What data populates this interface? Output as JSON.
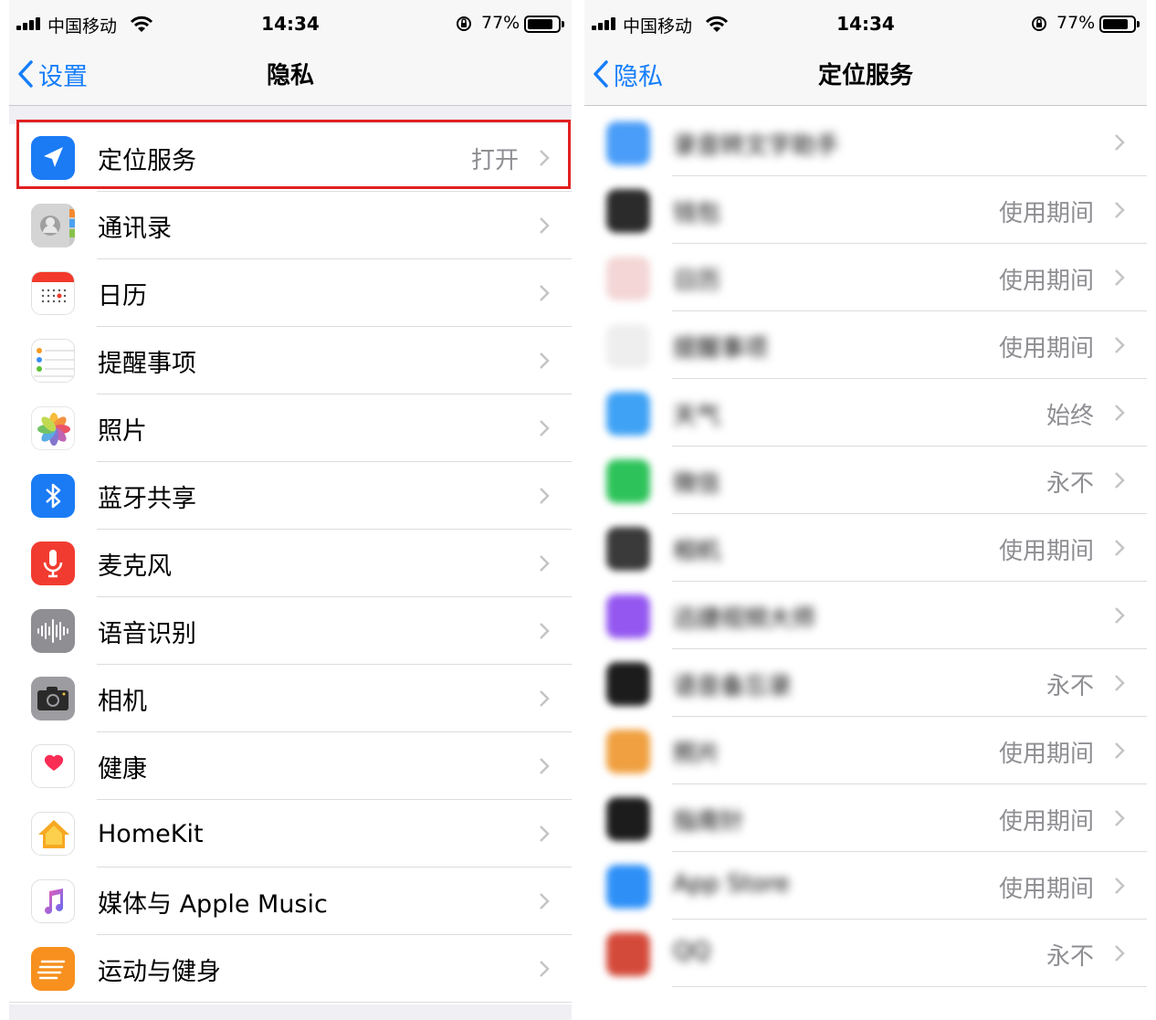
{
  "status_bar": {
    "carrier": "中国移动",
    "time": "14:34",
    "battery": "77%",
    "battery_level": 0.77
  },
  "left": {
    "nav": {
      "back_label": "设置",
      "title": "隐私"
    },
    "items": [
      {
        "label": "定位服务",
        "value": "打开",
        "icon": "location-arrow-icon",
        "color": "#1a7bf5"
      },
      {
        "label": "通讯录",
        "value": "",
        "icon": "contacts-icon",
        "color": "#bdbdbd"
      },
      {
        "label": "日历",
        "value": "",
        "icon": "calendar-icon",
        "color": "#ffffff"
      },
      {
        "label": "提醒事项",
        "value": "",
        "icon": "reminders-icon",
        "color": "#ffffff"
      },
      {
        "label": "照片",
        "value": "",
        "icon": "photos-icon",
        "color": "#ffffff"
      },
      {
        "label": "蓝牙共享",
        "value": "",
        "icon": "bluetooth-icon",
        "color": "#1a7bf5"
      },
      {
        "label": "麦克风",
        "value": "",
        "icon": "microphone-icon",
        "color": "#f23b30"
      },
      {
        "label": "语音识别",
        "value": "",
        "icon": "waveform-icon",
        "color": "#8e8e93"
      },
      {
        "label": "相机",
        "value": "",
        "icon": "camera-icon",
        "color": "#8e8e93"
      },
      {
        "label": "健康",
        "value": "",
        "icon": "heart-icon",
        "color": "#ffffff"
      },
      {
        "label": "HomeKit",
        "value": "",
        "icon": "home-icon",
        "color": "#ffffff"
      },
      {
        "label": "媒体与 Apple Music",
        "value": "",
        "icon": "music-note-icon",
        "color": "#ffffff"
      },
      {
        "label": "运动与健身",
        "value": "",
        "icon": "fitness-icon",
        "color": "#f7901e"
      }
    ]
  },
  "right": {
    "nav": {
      "back_label": "隐私",
      "title": "定位服务"
    },
    "items": [
      {
        "label": "录音转文字助手",
        "value": "",
        "icon": "app-icon-blurred",
        "color": "#4a9df8"
      },
      {
        "label": "钱包",
        "value": "使用期间",
        "icon": "wallet-icon",
        "color": "#2b2b2b"
      },
      {
        "label": "日历",
        "value": "使用期间",
        "icon": "calendar-icon",
        "color": "#f4d6d6"
      },
      {
        "label": "提醒事项",
        "value": "使用期间",
        "icon": "reminders-icon",
        "color": "#eeeeee"
      },
      {
        "label": "天气",
        "value": "始终",
        "icon": "weather-icon",
        "color": "#3fa2f5"
      },
      {
        "label": "微信",
        "value": "永不",
        "icon": "wechat-icon",
        "color": "#2dc35a"
      },
      {
        "label": "相机",
        "value": "使用期间",
        "icon": "camera-icon",
        "color": "#3a3a3a"
      },
      {
        "label": "迅捷视频大师",
        "value": "",
        "icon": "video-app-icon",
        "color": "#9457f0"
      },
      {
        "label": "语音备忘录",
        "value": "永不",
        "icon": "voice-memo-icon",
        "color": "#1c1c1c"
      },
      {
        "label": "照片",
        "value": "使用期间",
        "icon": "photos-icon",
        "color": "#f0a040"
      },
      {
        "label": "指南针",
        "value": "使用期间",
        "icon": "compass-icon",
        "color": "#1c1c1c"
      },
      {
        "label": "App Store",
        "value": "使用期间",
        "icon": "app-store-icon",
        "color": "#2e90f7"
      },
      {
        "label": "QQ",
        "value": "永不",
        "icon": "qq-icon",
        "color": "#d44a3a"
      }
    ]
  }
}
